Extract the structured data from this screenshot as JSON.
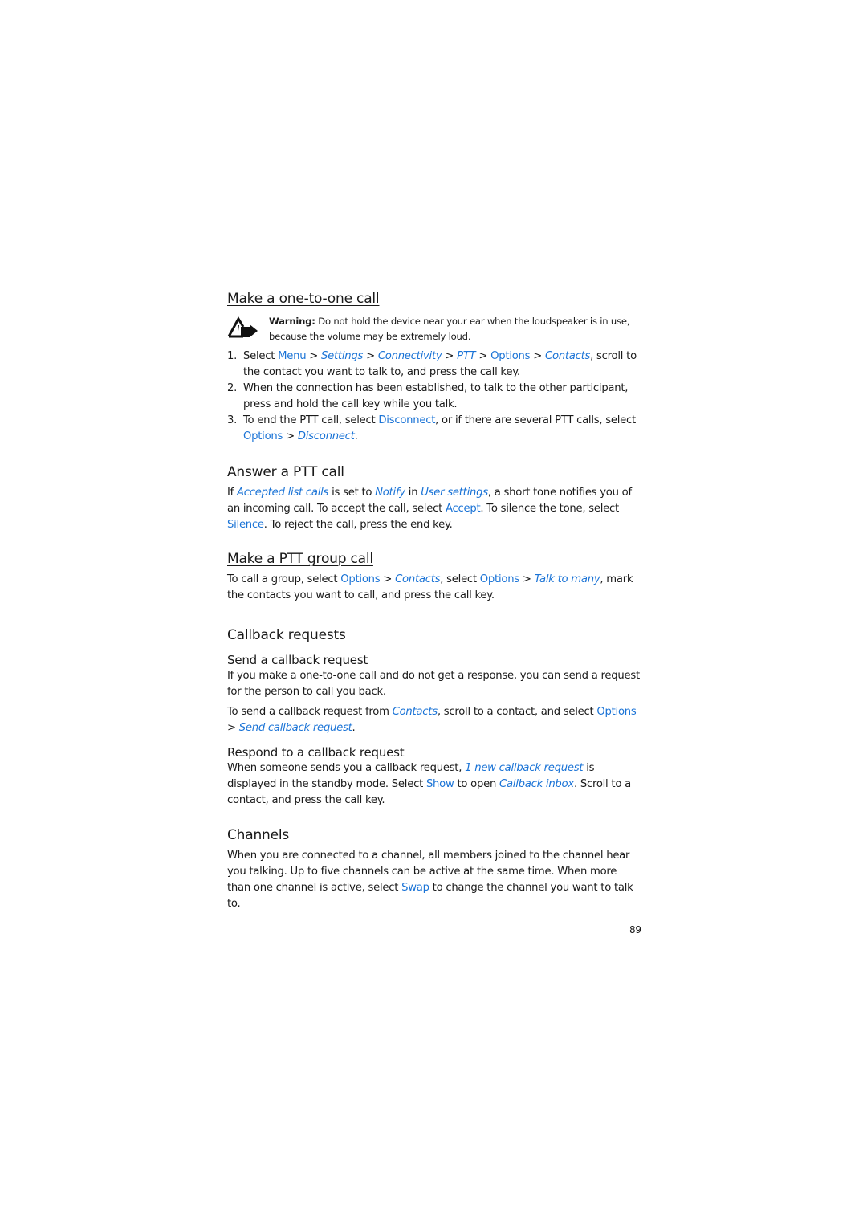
{
  "colors": {
    "link": "#1a73d6",
    "text": "#1a1a1a"
  },
  "section1": {
    "title": "Make a one-to-one call",
    "warning_icon": "warning-triangle-hand-icon",
    "warning_label": "Warning:",
    "warning_text": " Do not hold the device near your ear when the loudspeaker is in use, because the volume may be extremely loud.",
    "steps": [
      {
        "num": "1.",
        "parts": {
          "a": "Select ",
          "b": "Menu",
          "c": " > ",
          "d": "Settings",
          "e": " > ",
          "f": "Connectivity",
          "g": " > ",
          "h": "PTT",
          "i": " > ",
          "j": "Options",
          "k": " > ",
          "l": "Contacts",
          "m": ", scroll to the contact you want to talk to, and press the call key."
        }
      },
      {
        "num": "2.",
        "text": "When the connection has been established, to talk to the other participant, press and hold the call key while you talk."
      },
      {
        "num": "3.",
        "parts": {
          "a": "To end the PTT call, select ",
          "b": "Disconnect",
          "c": ", or if there are several PTT calls, select ",
          "d": "Options",
          "e": " > ",
          "f": "Disconnect",
          "g": "."
        }
      }
    ]
  },
  "section2": {
    "title": "Answer a PTT call",
    "parts": {
      "a": "If ",
      "b": "Accepted list calls",
      "c": " is set to ",
      "d": "Notify",
      "e": " in ",
      "f": "User settings",
      "g": ", a short tone notifies you of an incoming call. To accept the call, select ",
      "h": "Accept",
      "i": ". To silence the tone, select ",
      "j": "Silence",
      "k": ". To reject the call, press the end key."
    }
  },
  "section3": {
    "title": "Make a PTT group call",
    "parts": {
      "a": "To call a group, select ",
      "b": "Options",
      "c": " > ",
      "d": "Contacts",
      "e": ", select ",
      "f": "Options",
      "g": " > ",
      "h": "Talk to many",
      "i": ", mark the contacts you want to call, and press the call key."
    }
  },
  "section4": {
    "title": "Callback requests",
    "sub1": {
      "title": "Send a callback request",
      "p1": "If you make a one-to-one call and do not get a response, you can send a request for the person to call you back.",
      "p2": {
        "a": "To send a callback request from ",
        "b": "Contacts",
        "c": ", scroll to a contact, and select ",
        "d": "Options",
        "e": " > ",
        "f": "Send callback request",
        "g": "."
      }
    },
    "sub2": {
      "title": "Respond to a callback request",
      "p": {
        "a": "When someone sends you a callback request, ",
        "b": "1 new callback request",
        "c": " is displayed in the standby mode. Select ",
        "d": "Show",
        "e": " to open ",
        "f": "Callback inbox",
        "g": ". Scroll to a contact, and press the call key."
      }
    }
  },
  "section5": {
    "title": "Channels",
    "parts": {
      "a": "When you are connected to a channel, all members joined to the channel hear you talking. Up to five channels can be active at the same time. When more than one channel is active, select ",
      "b": "Swap",
      "c": " to change the channel you want to talk to."
    }
  },
  "page_number": "89"
}
